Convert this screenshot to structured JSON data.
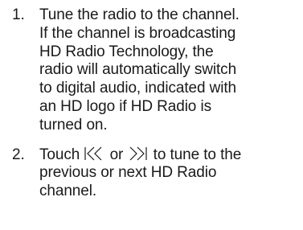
{
  "steps": [
    {
      "number": "1.",
      "lines": [
        "Tune the radio to the channel.",
        "If the channel is broadcasting",
        "HD Radio Technology, the",
        "radio will automatically switch",
        "to digital audio, indicated with",
        "an HD logo if HD Radio is",
        "turned on."
      ]
    },
    {
      "number": "2.",
      "touch_text": "Touch",
      "prev_icon": "seek-previous-icon",
      "or_text": "or",
      "next_icon": "seek-next-icon",
      "line1_tail": "to tune to the",
      "lines": [
        "previous or next HD Radio",
        "channel."
      ]
    }
  ]
}
